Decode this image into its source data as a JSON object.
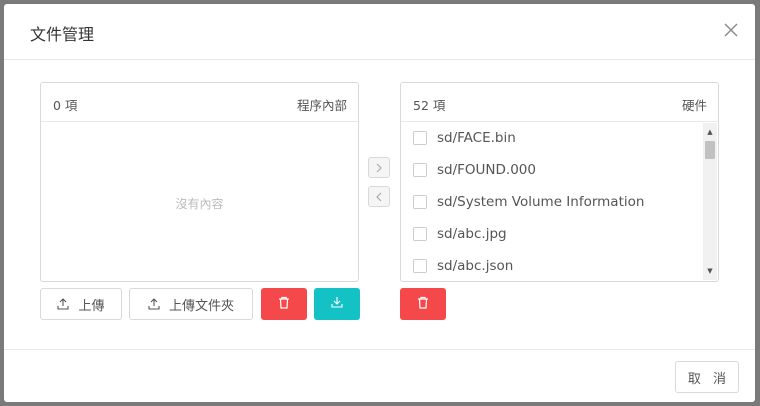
{
  "dialog": {
    "title": "文件管理",
    "cancel_label": "取 消"
  },
  "left_panel": {
    "count": "0 項",
    "title": "程序內部",
    "empty_text": "沒有內容",
    "upload_label": "上傳",
    "upload_folder_label": "上傳文件夾"
  },
  "right_panel": {
    "count": "52 項",
    "title": "硬件",
    "items": [
      "sd/FACE.bin",
      "sd/FOUND.000",
      "sd/System Volume Information",
      "sd/abc.jpg",
      "sd/abc.json"
    ]
  },
  "colors": {
    "danger": "#f4484a",
    "teal": "#14c1c5"
  }
}
